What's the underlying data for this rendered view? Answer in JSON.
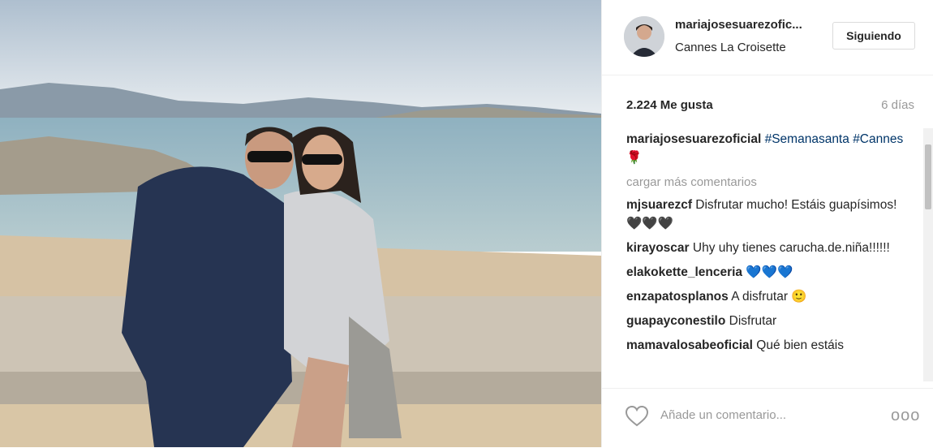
{
  "post": {
    "username": "mariajosesuarezofic...",
    "location": "Cannes La Croisette",
    "follow_label": "Siguiendo",
    "likes": "2.224 Me gusta",
    "time": "6 días"
  },
  "caption": {
    "username": "mariajosesuarezoficial",
    "tag1": "#Semanasanta",
    "tag2": "#Cannes",
    "emoji": "🌹"
  },
  "load_more": "cargar más comentarios",
  "comments": [
    {
      "user": "mjsuarezcf",
      "text": "Disfrutar mucho! Estáis guapísimos! 🖤🖤🖤"
    },
    {
      "user": "kirayoscar",
      "text": "Uhy uhy tienes carucha.de.niña!!!!!!"
    },
    {
      "user": "elakokette_lenceria",
      "text": "💙💙💙"
    },
    {
      "user": "enzapatosplanos",
      "text": "A disfrutar 🙂"
    },
    {
      "user": "guapayconestilo",
      "text": "Disfrutar"
    },
    {
      "user": "mamavalosabeoficial",
      "text": "Qué bien estáis"
    }
  ],
  "footer": {
    "add_comment_placeholder": "Añade un comentario...",
    "more_label": "ooo"
  },
  "icons": {
    "like": "heart-icon",
    "options": "more-options-icon"
  },
  "colors": {
    "hashtag": "#003569",
    "secondary_text": "#999999"
  }
}
